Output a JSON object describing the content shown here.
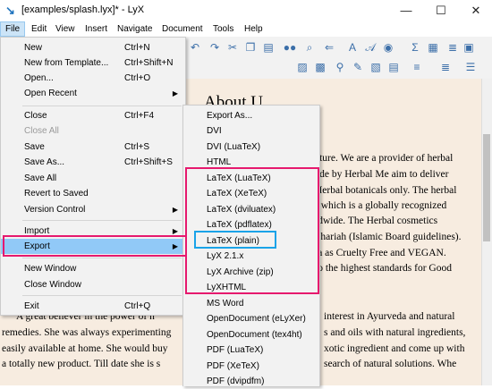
{
  "window": {
    "title": "[examples/splash.lyx]* - LyX",
    "app_icon": "lyx-icon",
    "minimize": "—",
    "maximize": "☐",
    "close": "✕"
  },
  "menubar": [
    "File",
    "Edit",
    "View",
    "Insert",
    "Navigate",
    "Document",
    "Tools",
    "Help"
  ],
  "file_menu": [
    {
      "label": "New",
      "shortcut": "Ctrl+N"
    },
    {
      "label": "New from Template...",
      "shortcut": "Ctrl+Shift+N"
    },
    {
      "label": "Open...",
      "shortcut": "Ctrl+O"
    },
    {
      "label": "Open Recent",
      "submenu": true
    },
    {
      "label": "Close",
      "shortcut": "Ctrl+F4"
    },
    {
      "label": "Close All",
      "disabled": true
    },
    {
      "label": "Save",
      "shortcut": "Ctrl+S"
    },
    {
      "label": "Save As...",
      "shortcut": "Ctrl+Shift+S"
    },
    {
      "label": "Save All"
    },
    {
      "label": "Revert to Saved"
    },
    {
      "label": "Version Control",
      "submenu": true
    },
    {
      "label": "Import",
      "submenu": true
    },
    {
      "label": "Export",
      "submenu": true,
      "highlighted": true
    },
    {
      "label": "New Window"
    },
    {
      "label": "Close Window"
    },
    {
      "label": "Exit",
      "shortcut": "Ctrl+Q"
    }
  ],
  "export_menu": [
    "Export As...",
    "DVI",
    "DVI (LuaTeX)",
    "HTML",
    "LaTeX (LuaTeX)",
    "LaTeX (XeTeX)",
    "LaTeX (dviluatex)",
    "LaTeX (pdflatex)",
    "LaTeX (plain)",
    "LyX 2.1.x",
    "LyX Archive (zip)",
    "LyXHTML",
    "MS Word",
    "OpenDocument (eLyXer)",
    "OpenDocument (tex4ht)",
    "PDF (LuaTeX)",
    "PDF (XeTeX)",
    "PDF (dvipdfm)"
  ],
  "document": {
    "title": "About U",
    "lines": [
      "ature. We are a provider of herbal",
      "ade by Herbal Me aim to deliver",
      "Herbal botanicals only. The herbal",
      ") which is a globally recognized",
      "ldwide. The Herbal cosmetics",
      "Shariah (Islamic Board guidelines).",
      "ia as Cruelty Free and VEGAN.",
      "to the highest standards for Good"
    ],
    "bottom_lines": [
      "A great believer in the power of n",
      "remedies. She was always experimenting",
      "easily available at home. She would buy",
      "a totally new product. Till date she is s"
    ],
    "bottom_right_lines": [
      "interest in Ayurveda and natural",
      "s and oils with natural ingredients,",
      "xotic ingredient and come up with",
      "search of natural solutions. Whe"
    ]
  },
  "colors": {
    "annotation_pink": "#e6196e",
    "annotation_blue": "#1aa3e8",
    "highlight": "#91c9f7",
    "doc_background": "#f7ece0"
  }
}
